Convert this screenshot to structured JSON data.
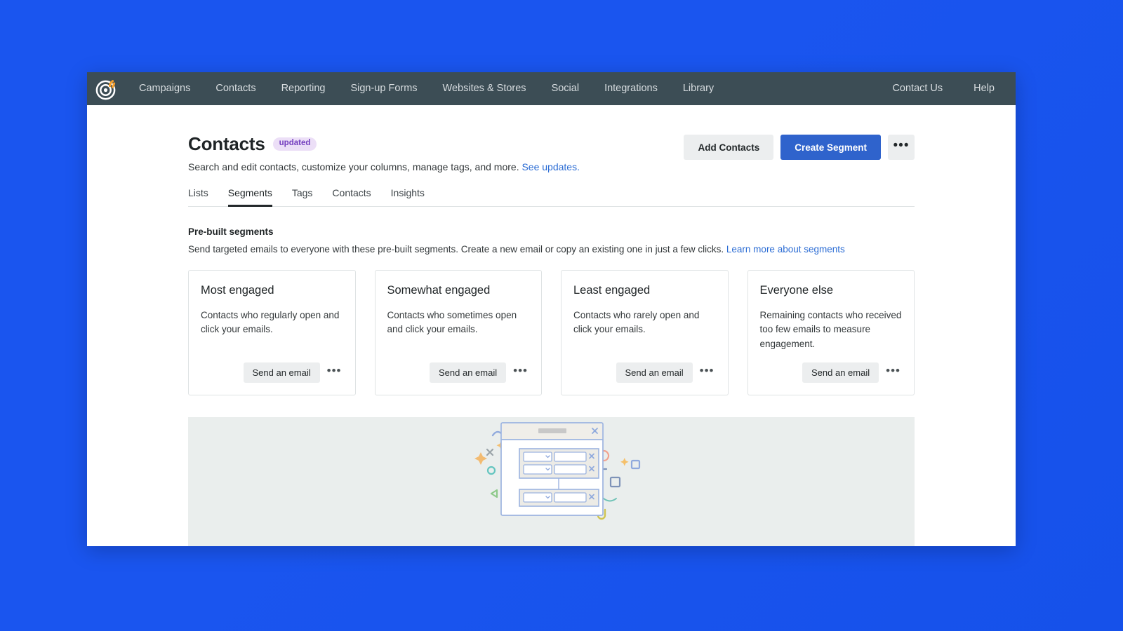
{
  "theme": {
    "desktop_background": "#1a55ef",
    "nav_background": "#3c4d55",
    "primary_button": "#2f63cc",
    "link_color": "#2b6cd4",
    "badge_background": "#ecdff7",
    "badge_text": "#7540bf",
    "panel_background": "#eaeeed"
  },
  "topnav": {
    "logo_name": "mailchimp-freddie-logo",
    "items": [
      {
        "label": "Campaigns"
      },
      {
        "label": "Contacts"
      },
      {
        "label": "Reporting"
      },
      {
        "label": "Sign-up Forms"
      },
      {
        "label": "Websites & Stores"
      },
      {
        "label": "Social"
      },
      {
        "label": "Integrations"
      },
      {
        "label": "Library"
      }
    ],
    "right_items": [
      {
        "label": "Contact Us"
      },
      {
        "label": "Help"
      }
    ]
  },
  "header": {
    "title": "Contacts",
    "badge": "updated",
    "subtitle": "Search and edit contacts, customize your columns, manage tags, and more.",
    "subtitle_link": "See updates.",
    "actions": {
      "add_contacts": "Add Contacts",
      "create_segment": "Create Segment",
      "more": "•••"
    }
  },
  "tabs": [
    {
      "label": "Lists",
      "active": false
    },
    {
      "label": "Segments",
      "active": true
    },
    {
      "label": "Tags",
      "active": false
    },
    {
      "label": "Contacts",
      "active": false
    },
    {
      "label": "Insights",
      "active": false
    }
  ],
  "prebuilt": {
    "title": "Pre-built segments",
    "description": "Send targeted emails to everyone with these pre-built segments. Create a new email or copy an existing one in just a few clicks.",
    "link": "Learn more about segments"
  },
  "cards": [
    {
      "title": "Most engaged",
      "description": "Contacts who regularly open and click your emails.",
      "send_label": "Send an email",
      "more": "•••"
    },
    {
      "title": "Somewhat engaged",
      "description": "Contacts who sometimes open and click your emails.",
      "send_label": "Send an email",
      "more": "•••"
    },
    {
      "title": "Least engaged",
      "description": "Contacts who rarely open and click your emails.",
      "send_label": "Send an email",
      "more": "•••"
    },
    {
      "title": "Everyone else",
      "description": "Remaining contacts who received too few emails to measure engagement.",
      "send_label": "Send an email",
      "more": "•••"
    }
  ],
  "illustration": {
    "name": "segment-builder-modal-illustration",
    "alt": "Illustration of a segment builder dialog with condition rows"
  }
}
